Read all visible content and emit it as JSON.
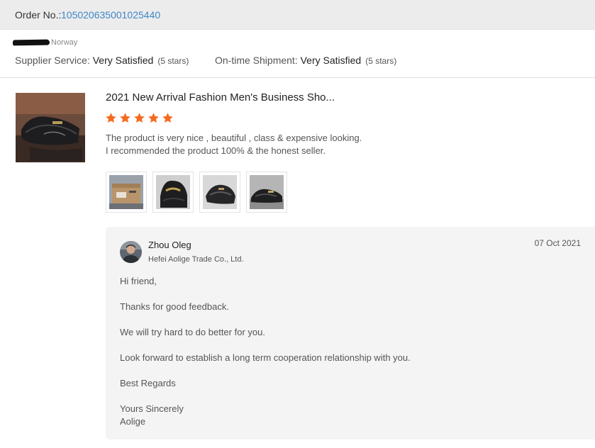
{
  "order": {
    "label": "Order No.: ",
    "number": "105020635001025440"
  },
  "buyer": {
    "country": "Norway"
  },
  "ratings": [
    {
      "label": "Supplier Service: ",
      "value": "Very Satisfied",
      "stars": "(5 stars)"
    },
    {
      "label": "On-time Shipment: ",
      "value": "Very Satisfied",
      "stars": "(5 stars)"
    }
  ],
  "product": {
    "title": "2021 New Arrival Fashion Men's Business Sho...",
    "star_rating": 5,
    "review": [
      "The product is very nice , beautiful , class & expensive looking.",
      "I recommended the product 100% & the honest seller."
    ]
  },
  "reply": {
    "seller_name": "Zhou Oleg",
    "company": "Hefei Aolige Trade Co., Ltd.",
    "date": "07 Oct 2021",
    "lines": [
      "Hi friend,",
      "Thanks for good feedback.",
      "We will try hard to do better for you.",
      "Look forward to establish a long term cooperation relationship with you.",
      "Best Regards",
      "Yours Sincerely",
      "Aolige"
    ]
  },
  "colors": {
    "accent_link": "#3f86c6",
    "star": "#f56a1f",
    "header_bg": "#ececec",
    "reply_bg": "#f4f4f4"
  },
  "icons": {
    "star": "star-icon"
  }
}
